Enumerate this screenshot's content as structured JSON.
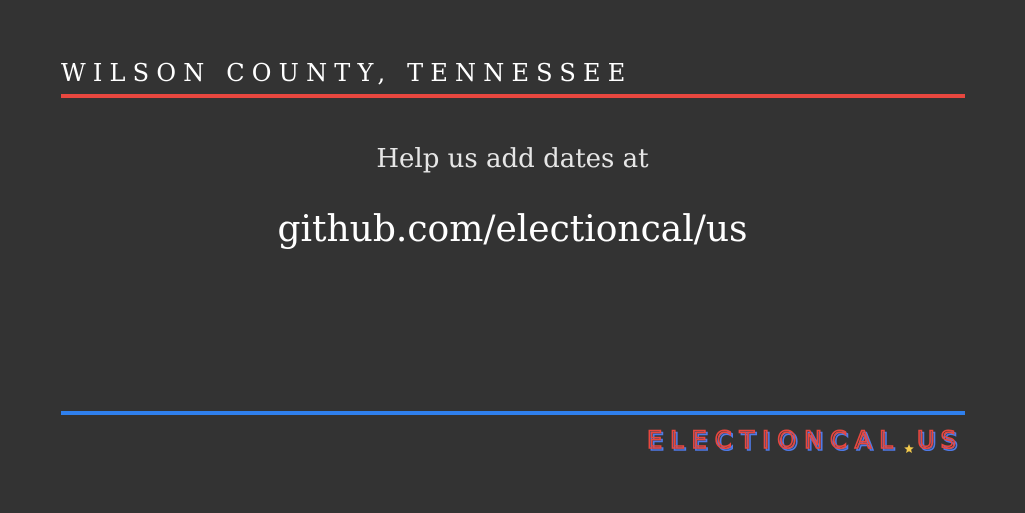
{
  "header": {
    "title": "WILSON COUNTY, TENNESSEE"
  },
  "main": {
    "help_text": "Help us add dates at",
    "repo_url": "github.com/electioncal/us"
  },
  "footer": {
    "brand_text": "ELECTIONCAL",
    "brand_tld": "US"
  },
  "colors": {
    "background": "#333333",
    "top_rule": "#e8473f",
    "bottom_rule": "#2f80ed",
    "brand_red": "#e8473f",
    "brand_blue": "#4f7ae6",
    "star": "#f2c94c"
  },
  "icons": {
    "brand_star": "star-icon"
  }
}
